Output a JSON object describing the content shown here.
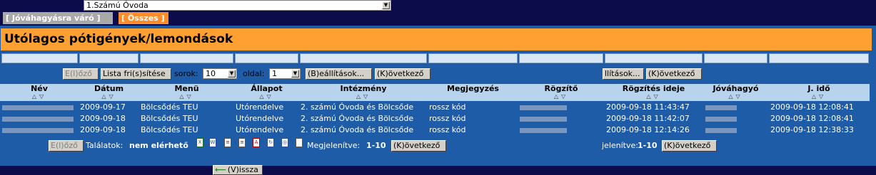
{
  "top_select": {
    "value": "1.Számú Óvoda"
  },
  "tabs": [
    {
      "label": "[ Jóváhagyásra váró ]"
    },
    {
      "label": "[ Összes ]"
    }
  ],
  "title": "Utólagos pótigények/lemondások",
  "toolbar": {
    "prev_label": "E(l)őző",
    "refresh_label": "Lista fri(s)sítése",
    "rows_label": "sorok:",
    "rows_value": "10",
    "page_label": "oldal:",
    "page_value": "1",
    "settings_label": "(B)eállítások...",
    "next_label": "(K)övetkező",
    "settings2_label": "llítások...",
    "next2_label": "(K)övetkező"
  },
  "columns": [
    "Név",
    "Dátum",
    "Menü",
    "Állapot",
    "Intézmény",
    "Megjegyzés",
    "Rögzítő",
    "Rögzítés ideje",
    "Jóváhagyó",
    "J. idő"
  ],
  "rows": [
    {
      "date": "2009-09-17",
      "menu": "Bölcsődés TEU",
      "state": "Utórendelve",
      "inst": "2. számú Óvoda és Bölcsőde",
      "note": "rossz kód",
      "rec_time": "2009-09-18 11:43:47",
      "appr_time": "2009-09-18 12:08:41"
    },
    {
      "date": "2009-09-18",
      "menu": "Bölcsődés TEU",
      "state": "Utórendelve",
      "inst": "2. számú Óvoda és Bölcsőde",
      "note": "rossz kód",
      "rec_time": "2009-09-18 11:42:07",
      "appr_time": "2009-09-18 12:08:41"
    },
    {
      "date": "2009-09-18",
      "menu": "Bölcsődés TEU",
      "state": "Utórendelve",
      "inst": "2. számú Óvoda és Bölcsőde",
      "note": "rossz kód",
      "rec_time": "2009-09-18 12:14:26",
      "appr_time": "2009-09-18 12:38:33"
    }
  ],
  "footer": {
    "prev_label": "E(l)őző",
    "results_label": "Találatok:",
    "results_value": "nem elérhető",
    "shown_label": "Megjelenítve:",
    "shown_value": "1-10",
    "next_label": "(K)övetkező",
    "shown2_label": "jelenítve:",
    "shown2_value": "1-10",
    "next2_label": "(K)övetkező"
  },
  "back_label": "(V)issza",
  "colors": {
    "accent": "#ffa033",
    "panel": "#1f5ca8",
    "header": "#b7d3ee",
    "background": "#0c0c4a"
  }
}
